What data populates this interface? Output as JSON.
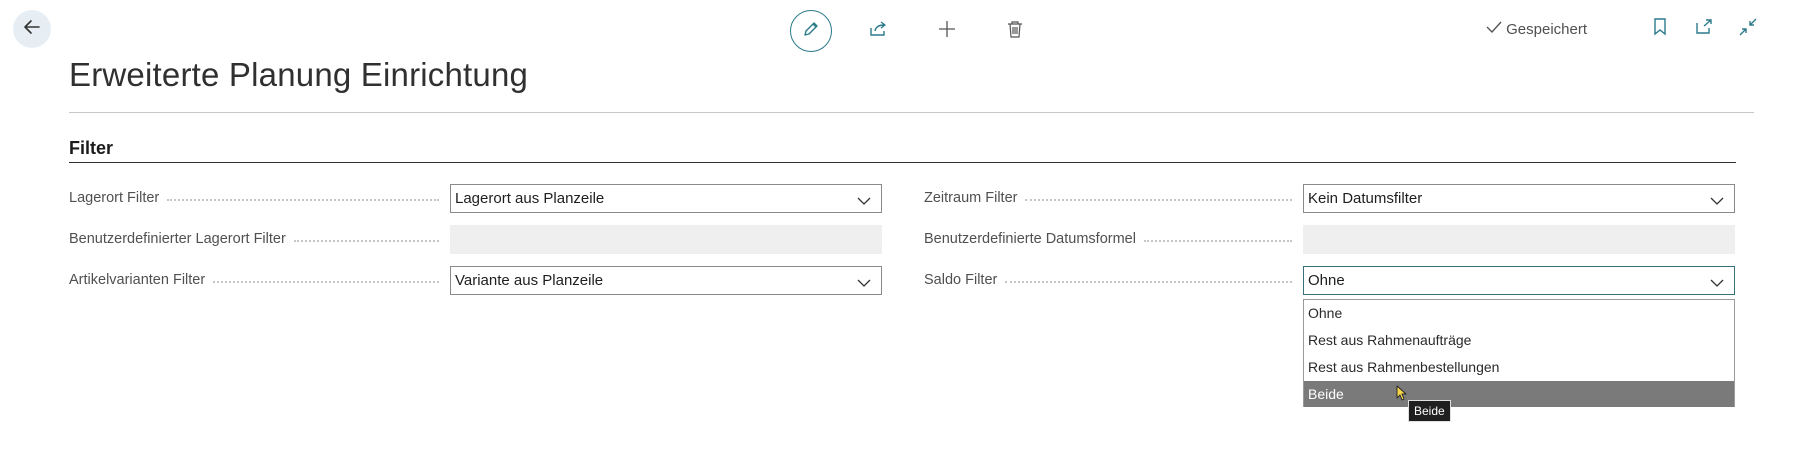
{
  "topbar": {
    "saved_label": "Gespeichert"
  },
  "page": {
    "title": "Erweiterte Planung Einrichtung"
  },
  "section": {
    "title": "Filter"
  },
  "fields_left": [
    {
      "label": "Lagerort Filter",
      "value": "Lagerort aus Planzeile",
      "type": "select"
    },
    {
      "label": "Benutzerdefinierter Lagerort Filter",
      "value": "",
      "type": "text-disabled"
    },
    {
      "label": "Artikelvarianten Filter",
      "value": "Variante aus Planzeile",
      "type": "select"
    }
  ],
  "fields_right": [
    {
      "label": "Zeitraum Filter",
      "value": "Kein Datumsfilter",
      "type": "select"
    },
    {
      "label": "Benutzerdefinierte Datumsformel",
      "value": "",
      "type": "text-disabled"
    },
    {
      "label": "Saldo Filter",
      "value": "Ohne",
      "type": "select"
    }
  ],
  "dropdown": {
    "options": [
      "Ohne",
      "Rest aus Rahmenaufträge",
      "Rest aus Rahmenbestellungen",
      "Beide"
    ],
    "highlighted": "Beide"
  },
  "tooltip": {
    "text": "Beide"
  },
  "colors": {
    "accent": "#2b7a8a",
    "highlight_row": "#7a7a7a",
    "disabled_field": "#f0eff0"
  }
}
